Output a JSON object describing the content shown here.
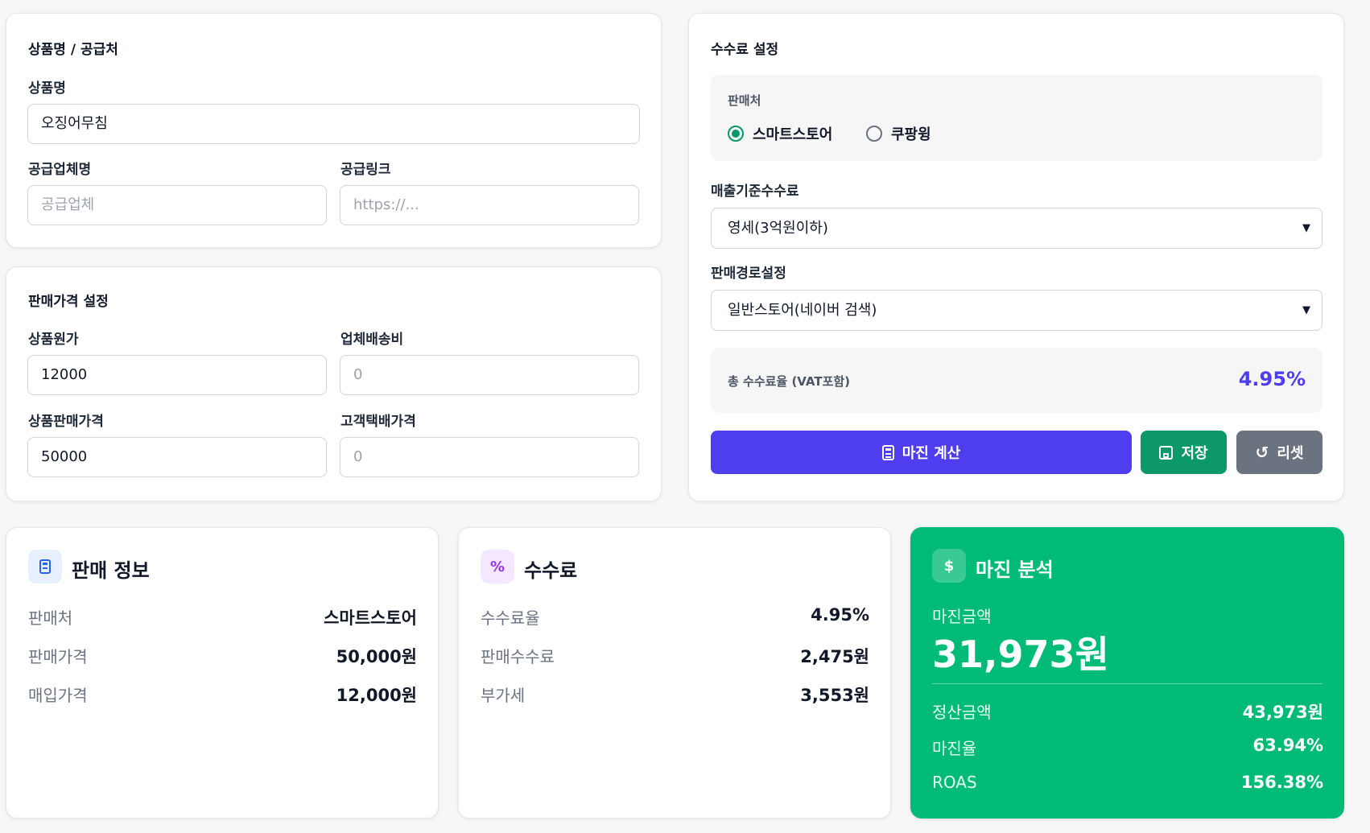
{
  "product_card": {
    "title": "상품명 / 공급처",
    "name_label": "상품명",
    "name_value": "오징어무침",
    "supplier_label": "공급업체명",
    "supplier_placeholder": "공급업체",
    "link_label": "공급링크",
    "link_placeholder": "https://..."
  },
  "price_card": {
    "title": "판매가격 설정",
    "cost_label": "상품원가",
    "cost_value": "12000",
    "ship_label": "업체배송비",
    "ship_placeholder": "0",
    "sale_label": "상품판매가격",
    "sale_value": "50000",
    "customer_ship_label": "고객택배가격",
    "customer_ship_placeholder": "0"
  },
  "fee_card": {
    "title": "수수료 설정",
    "seller_label": "판매처",
    "seller_options": [
      "스마트스토어",
      "쿠팡윙"
    ],
    "seller_selected": "스마트스토어",
    "sales_fee_label": "매출기준수수료",
    "sales_fee_value": "영세(3억원이하)",
    "route_label": "판매경로설정",
    "route_value": "일반스토어(네이버 검색)",
    "total_label": "총 수수료율 (VAT포함)",
    "total_value": "4.95%",
    "calc_button": "마진 계산",
    "save_button": "저장",
    "reset_button": "리셋"
  },
  "sales_info": {
    "title": "판매 정보",
    "rows": [
      {
        "label": "판매처",
        "value": "스마트스토어"
      },
      {
        "label": "판매가격",
        "value": "50,000원"
      },
      {
        "label": "매입가격",
        "value": "12,000원"
      }
    ]
  },
  "fees": {
    "title": "수수료",
    "icon_glyph": "%",
    "rows": [
      {
        "label": "수수료율",
        "value": "4.95%"
      },
      {
        "label": "판매수수료",
        "value": "2,475원"
      },
      {
        "label": "부가세",
        "value": "3,553원"
      }
    ]
  },
  "margin": {
    "title": "마진 분석",
    "icon_glyph": "$",
    "amount_label": "마진금액",
    "amount_value": "31,973원",
    "rows": [
      {
        "label": "정산금액",
        "value": "43,973원"
      },
      {
        "label": "마진율",
        "value": "63.94%"
      },
      {
        "label": "ROAS",
        "value": "156.38%"
      }
    ]
  },
  "colors": {
    "primary": "#4f3df0",
    "save_green": "#0c9868",
    "reset_gray": "#6b7280",
    "margin_green": "#00ba78",
    "radio_green": "#059669"
  }
}
